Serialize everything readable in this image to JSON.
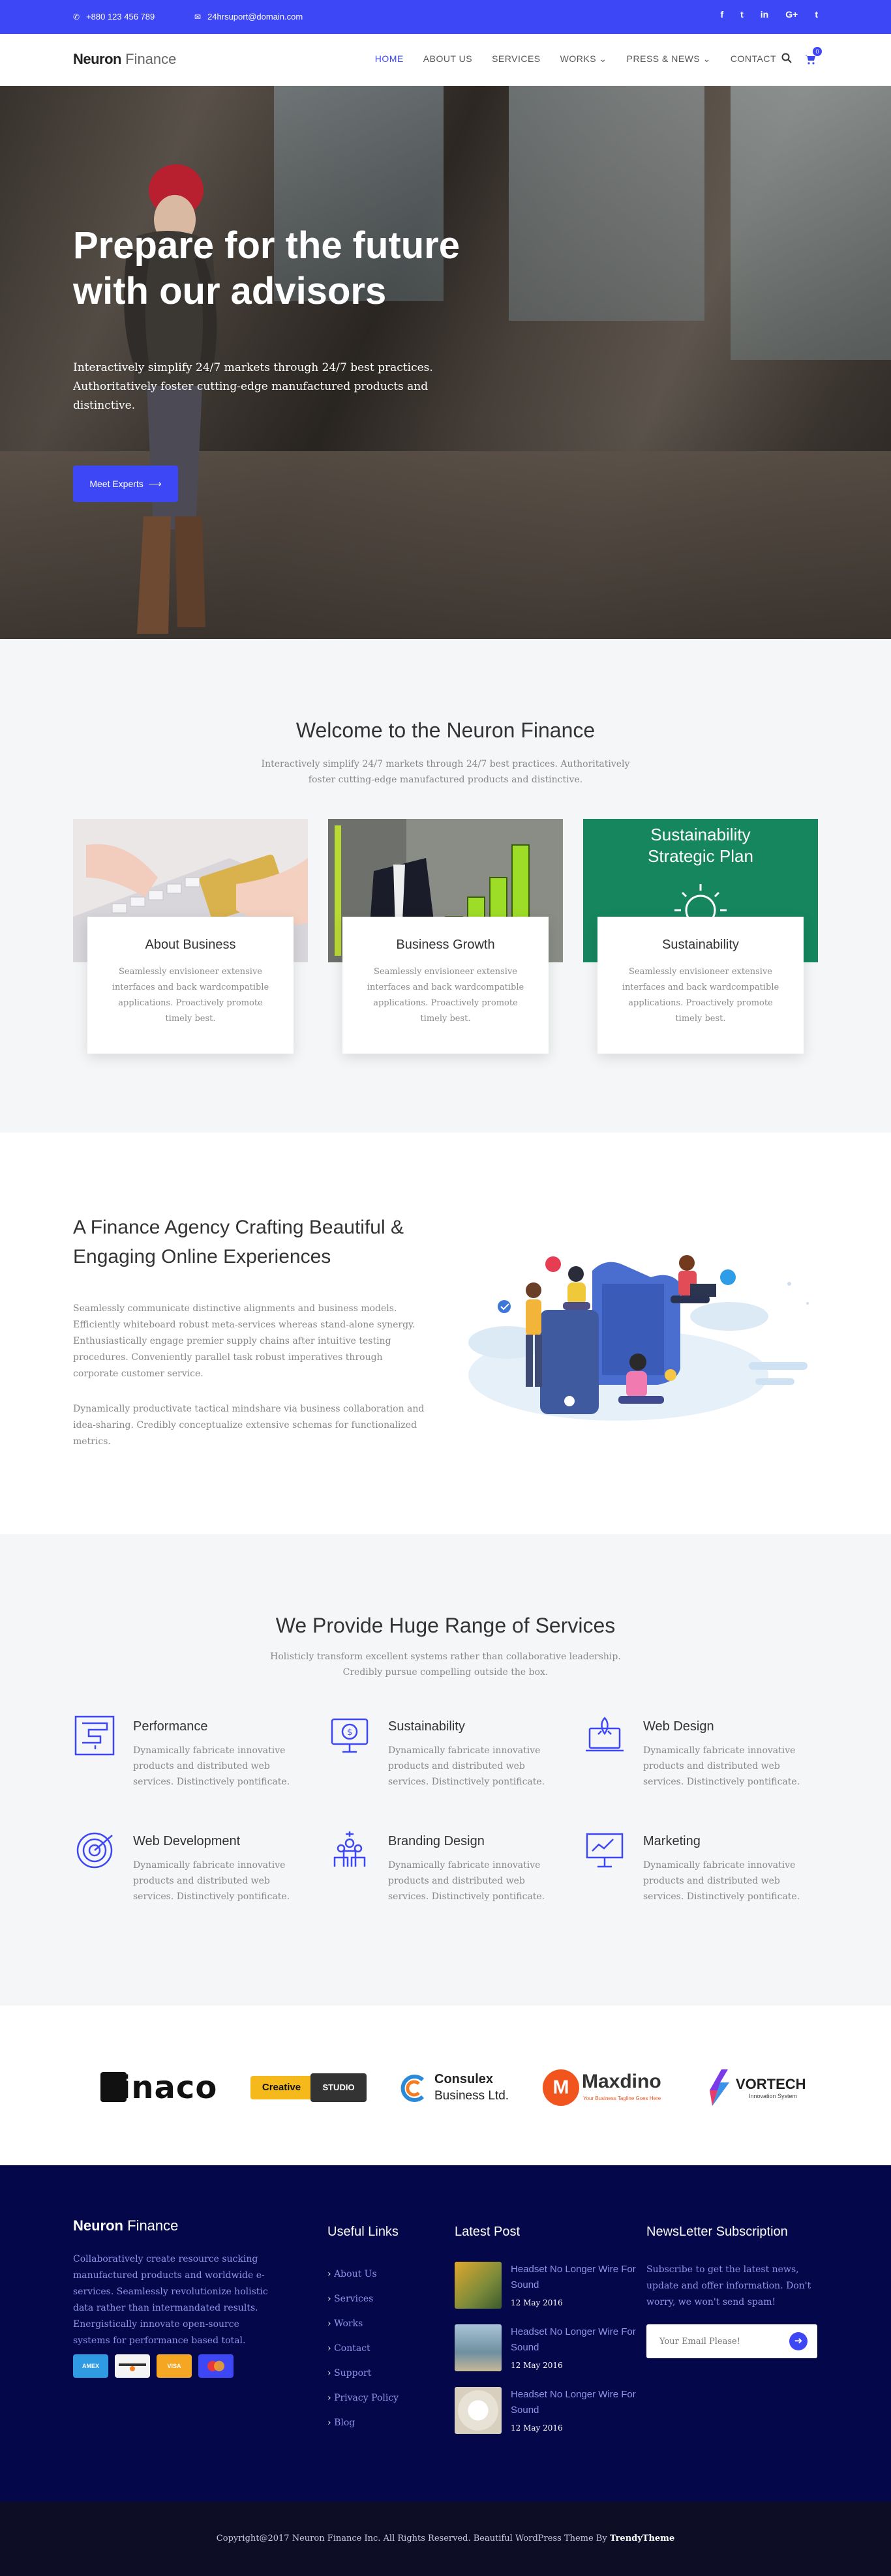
{
  "topbar": {
    "phone": "+880 123 456 789",
    "email": "24hrsuport@domain.com",
    "socials": [
      "f",
      "t",
      "in",
      "G+",
      "t"
    ],
    "phone_icon": "phone-icon",
    "email_icon": "envelope-icon"
  },
  "nav": {
    "logo_bold": "Neuron",
    "logo_light": "Finance",
    "items": [
      "HOME",
      "ABOUT US",
      "SERVICES",
      "WORKS",
      "PRESS & NEWS",
      "CONTACT"
    ],
    "cart_count": "0"
  },
  "hero": {
    "title_line1": "Prepare for the future",
    "title_line2": "with our advisors",
    "text": "Interactively simplify 24/7 markets through 24/7 best practices. Authoritatively foster cutting-edge manufactured products and distinctive.",
    "button": "Meet Experts"
  },
  "welcome": {
    "title": "Welcome to the Neuron Finance",
    "subtitle": "Interactively simplify 24/7 markets through 24/7 best practices. Authoritatively foster cutting-edge manufactured products and distinctive.",
    "cards": [
      {
        "title": "About Business",
        "text": "Seamlessly envisioneer extensive interfaces and back wardcompatible applications. Proactively promote timely best."
      },
      {
        "title": "Business Growth",
        "text": "Seamlessly envisioneer extensive interfaces and back wardcompatible applications. Proactively promote timely best."
      },
      {
        "title": "Sustainability",
        "text": "Seamlessly envisioneer extensive interfaces and back wardcompatible applications. Proactively promote timely best."
      }
    ],
    "board_line1": "Sustainability",
    "board_line2": "Strategic Plan"
  },
  "agency": {
    "title": "A Finance Agency Crafting Beautiful & Engaging Online Experiences",
    "para1": "Seamlessly communicate distinctive alignments and business models. Efficiently whiteboard robust meta-services whereas stand-alone synergy. Enthusiastically engage premier supply chains after intuitive testing procedures. Conveniently parallel task robust imperatives through corporate customer service.",
    "para2": "Dynamically productivate tactical mindshare via business collaboration and idea-sharing. Credibly conceptualize extensive schemas for functionalized metrics."
  },
  "services": {
    "title": "We Provide Huge Range of Services",
    "subtitle": "Holisticly transform excellent systems rather than collaborative leadership. Credibly pursue compelling outside the box.",
    "items": [
      {
        "title": "Performance",
        "text": "Dynamically fabricate innovative products and distributed web services. Distinctively pontificate.",
        "icon": "maze-icon"
      },
      {
        "title": "Sustainability",
        "text": "Dynamically fabricate innovative products and distributed web services. Distinctively pontificate.",
        "icon": "money-screen-icon"
      },
      {
        "title": "Web Design",
        "text": "Dynamically fabricate innovative products and distributed web services. Distinctively pontificate.",
        "icon": "rocket-laptop-icon"
      },
      {
        "title": "Web Development",
        "text": "Dynamically fabricate innovative products and distributed web services. Distinctively pontificate.",
        "icon": "target-icon"
      },
      {
        "title": "Branding Design",
        "text": "Dynamically fabricate innovative products and distributed web services. Distinctively pontificate.",
        "icon": "team-icon"
      },
      {
        "title": "Marketing",
        "text": "Dynamically fabricate innovative products and distributed web services. Distinctively pontificate.",
        "icon": "presentation-icon"
      }
    ]
  },
  "clients": {
    "finaco": "finaco",
    "creative_a": "Creative",
    "creative_b": "STUDIO",
    "consulex_a": "Consulex",
    "consulex_b": "Business Ltd.",
    "maxdino": "Maxdino",
    "maxdino_sub": "Your Business Tagline Goes Here",
    "vortech": "VORTECH",
    "vortech_sub": "Innovation System"
  },
  "footer": {
    "logo_bold": "Neuron",
    "logo_light": "Finance",
    "about": "Collaboratively create resource sucking manufactured products and worldwide e-services. Seamlessly revolutionize holistic data rather than intermandated results. Energistically innovate open-source systems for performance based total.",
    "cards": [
      "AMEX",
      "",
      "VISA",
      ""
    ],
    "links_title": "Useful Links",
    "links": [
      "About Us",
      "Services",
      "Works",
      "Contact",
      "Support",
      "Privacy Policy",
      "Blog"
    ],
    "posts_title": "Latest Post",
    "posts": [
      {
        "title": "Headset No Longer Wire For Sound",
        "date": "12 May 2016"
      },
      {
        "title": "Headset No Longer Wire For Sound",
        "date": "12 May 2016"
      },
      {
        "title": "Headset No Longer Wire For Sound",
        "date": "12 May 2016"
      }
    ],
    "news_title": "NewsLetter Subscription",
    "news_text": "Subscribe to get the latest news, update and offer information. Don't worry, we won't send spam!",
    "email_placeholder": "Your Email Please!"
  },
  "copyright": {
    "text": "Copyright@2017 Neuron Finance Inc. All Rights Reserved. Beautiful WordPress Theme By ",
    "brand": "TrendyTheme"
  },
  "colors": {
    "accent": "#3d47f5",
    "footer": "#04074a",
    "copy": "#0e0d26",
    "section_bg": "#f4f6f8"
  }
}
